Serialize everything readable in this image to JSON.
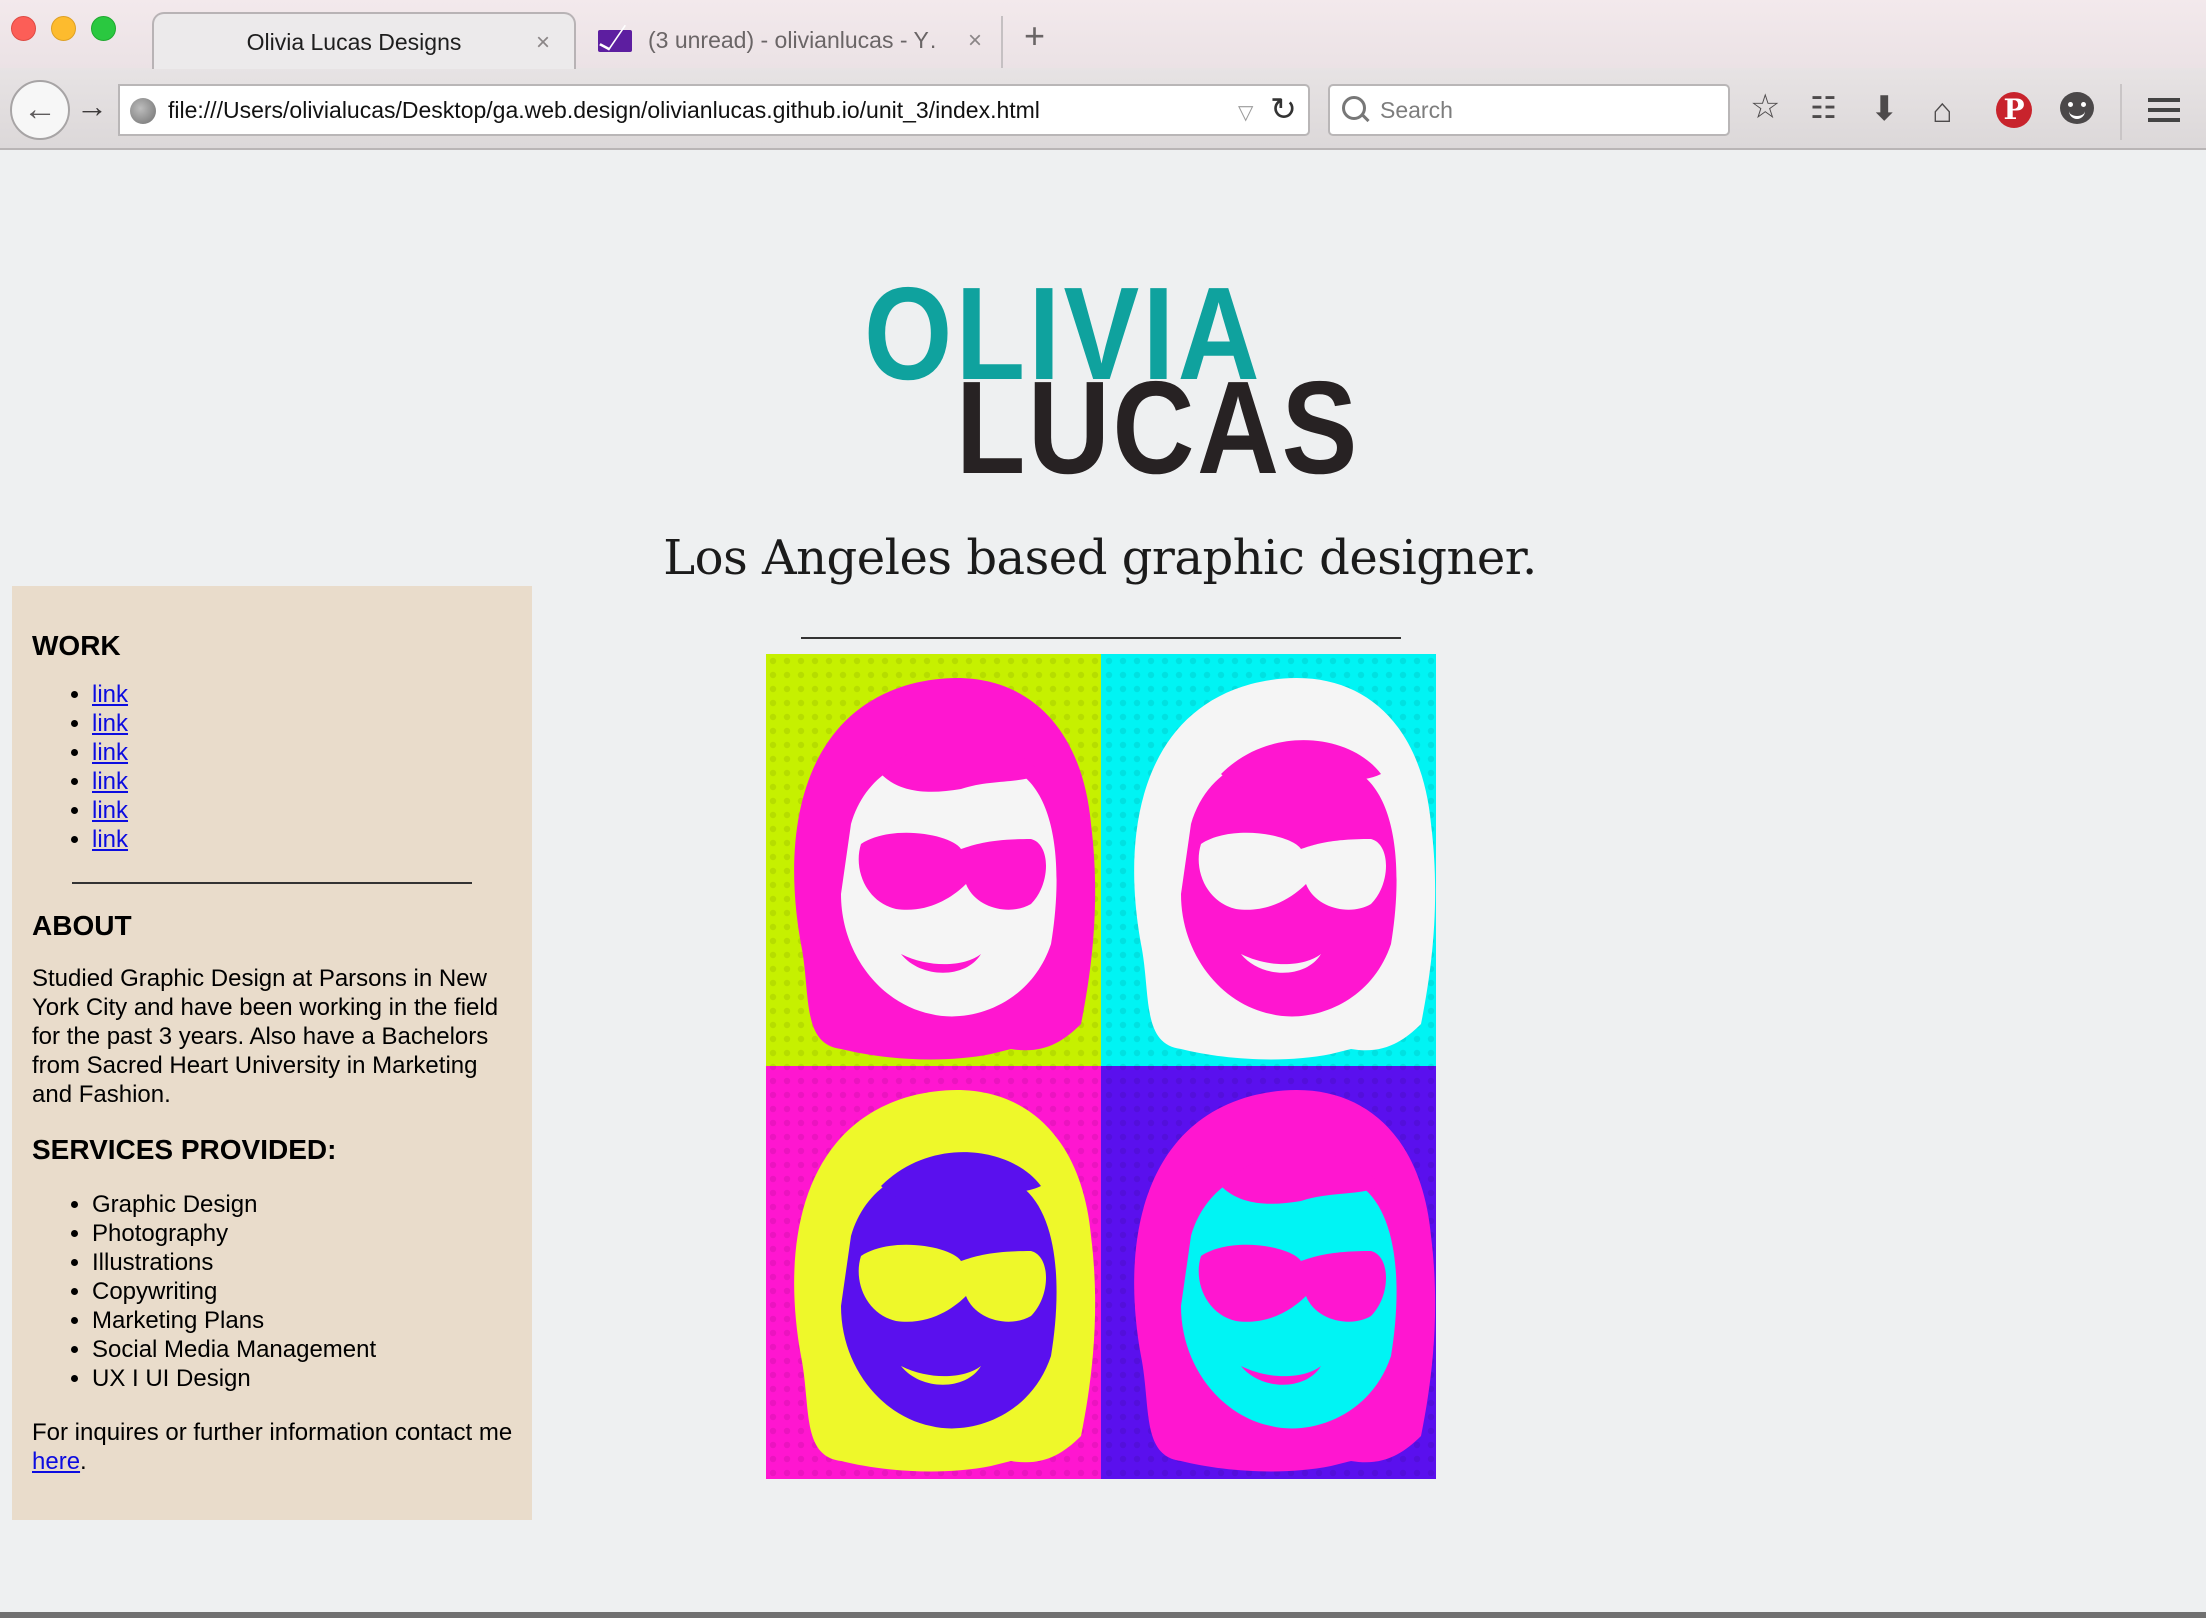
{
  "browser": {
    "tabs": [
      {
        "title": "Olivia Lucas Designs",
        "active": true
      },
      {
        "title": "(3 unread) - olivianlucas - Y…",
        "active": false
      }
    ],
    "url": "file:///Users/olivialucas/Desktop/ga.web.design/olivianlucas.github.io/unit_3/index.html",
    "search_placeholder": "Search",
    "new_tab_label": "+",
    "close_glyph": "×"
  },
  "page": {
    "logo": {
      "top": "OLIVIA",
      "bottom": "LUCAS"
    },
    "tagline": "Los Angeles based graphic designer.",
    "work": {
      "heading": "WORK",
      "links": [
        "link",
        "link",
        "link",
        "link",
        "link",
        "link"
      ]
    },
    "about": {
      "heading": "ABOUT",
      "text": "Studied Graphic Design at Parsons in New York City and have been working in the field for the past 3 years. Also have a Bachelors from Sacred Heart University in Marketing and Fashion."
    },
    "services": {
      "heading": "SERVICES PROVIDED:",
      "items": [
        "Graphic Design",
        "Photography",
        "Illustrations",
        "Copywriting",
        "Marketing Plans",
        "Social Media Management",
        "UX I UI Design"
      ]
    },
    "contact": {
      "text": "For inquires or further information contact me ",
      "link": "here",
      "suffix": "."
    }
  },
  "colors": {
    "logo_teal": "#0fa29e",
    "logo_dark": "#272223",
    "sidebar_bg": "#e9dccb",
    "link": "#0c0ce0",
    "pop_lime": "#c6f000",
    "pop_cyan": "#00f4f4",
    "pop_magenta": "#ff16d0",
    "pop_violet": "#5a10ee",
    "pop_yellow": "#eef82a"
  }
}
